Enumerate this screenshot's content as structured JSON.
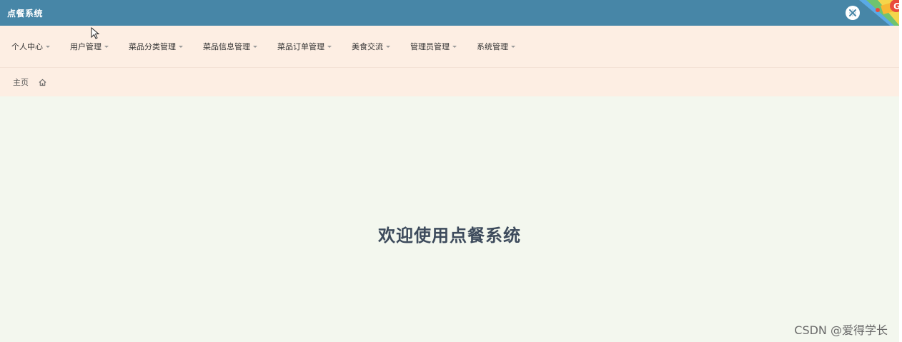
{
  "header": {
    "app_title": "点餐系统",
    "close_icon": "close-circle-icon",
    "colors": {
      "topbar": "#4786a7",
      "nav_bg": "#fdeee3",
      "content_bg": "#f3f7ee"
    }
  },
  "nav": {
    "items": [
      {
        "label": "个人中心"
      },
      {
        "label": "用户管理"
      },
      {
        "label": "菜品分类管理"
      },
      {
        "label": "菜品信息管理"
      },
      {
        "label": "菜品订单管理"
      },
      {
        "label": "美食交流"
      },
      {
        "label": "管理员管理"
      },
      {
        "label": "系统管理"
      }
    ]
  },
  "breadcrumb": {
    "home_label": "主页",
    "home_icon": "home-icon"
  },
  "main": {
    "welcome_text": "欢迎使用点餐系统"
  },
  "watermark": {
    "text": "CSDN @爱得学长"
  }
}
